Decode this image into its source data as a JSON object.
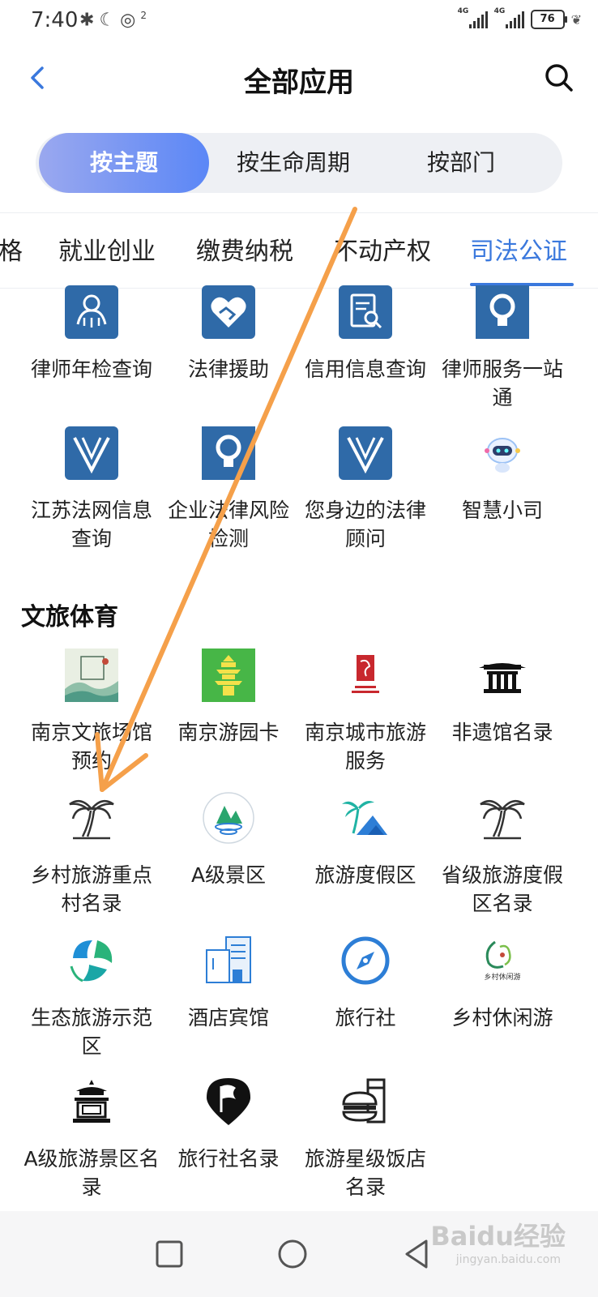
{
  "status": {
    "time": "7:40",
    "battery": "76",
    "net1": "4G",
    "net2": "4G",
    "hotspot_count": "2"
  },
  "header": {
    "title": "全部应用"
  },
  "segments": [
    {
      "label": "按主题",
      "active": true
    },
    {
      "label": "按生命周期",
      "active": false
    },
    {
      "label": "按部门",
      "active": false
    }
  ],
  "categories": [
    "格",
    "就业创业",
    "缴费纳税",
    "不动产权",
    "司法公证"
  ],
  "active_category": "司法公证",
  "justice_apps": [
    {
      "label": "律师年检查询",
      "icon": "scales-icon"
    },
    {
      "label": "法律援助",
      "icon": "handshake-heart-icon"
    },
    {
      "label": "信用信息查询",
      "icon": "document-search-icon"
    },
    {
      "label": "律师服务一站通",
      "icon": "lightbulb-icon"
    },
    {
      "label": "江苏法网信息查询",
      "icon": "v-logo-icon"
    },
    {
      "label": "企业法律风险检测",
      "icon": "lightbulb-icon"
    },
    {
      "label": "您身边的法律顾问",
      "icon": "v-logo-icon"
    },
    {
      "label": "智慧小司",
      "icon": "robot-icon"
    }
  ],
  "section_title": "文旅体育",
  "tourism_apps": [
    {
      "label": "南京文旅场馆预约",
      "icon": "nanjing-booking-icon"
    },
    {
      "label": "南京游园卡",
      "icon": "pagoda-icon"
    },
    {
      "label": "南京城市旅游服务",
      "icon": "nanjing-seal-icon"
    },
    {
      "label": "非遗馆名录",
      "icon": "pavilion-icon"
    },
    {
      "label": "乡村旅游重点村名录",
      "icon": "palm-tree-icon"
    },
    {
      "label": "A级景区",
      "icon": "mountain-water-icon"
    },
    {
      "label": "旅游度假区",
      "icon": "palm-mountain-icon"
    },
    {
      "label": "省级旅游度假区名录",
      "icon": "palm-tree-icon"
    },
    {
      "label": "生态旅游示范区",
      "icon": "eco-leaf-icon"
    },
    {
      "label": "酒店宾馆",
      "icon": "hotel-building-icon"
    },
    {
      "label": "旅行社",
      "icon": "compass-icon"
    },
    {
      "label": "乡村休闲游",
      "icon": "rural-leisure-icon"
    },
    {
      "label": "A级旅游景区名录",
      "icon": "temple-icon"
    },
    {
      "label": "旅行社名录",
      "icon": "flag-pin-icon"
    },
    {
      "label": "旅游星级饭店名录",
      "icon": "food-drink-icon"
    }
  ],
  "rural_leisure_text": "乡村休闲游",
  "watermark": {
    "text": "Baidu经验",
    "sub": "jingyan.baidu.com"
  },
  "colors": {
    "accent": "#3a78dd",
    "gov_blue": "#2f6aa8",
    "annotation_arrow": "#f5a04a"
  }
}
